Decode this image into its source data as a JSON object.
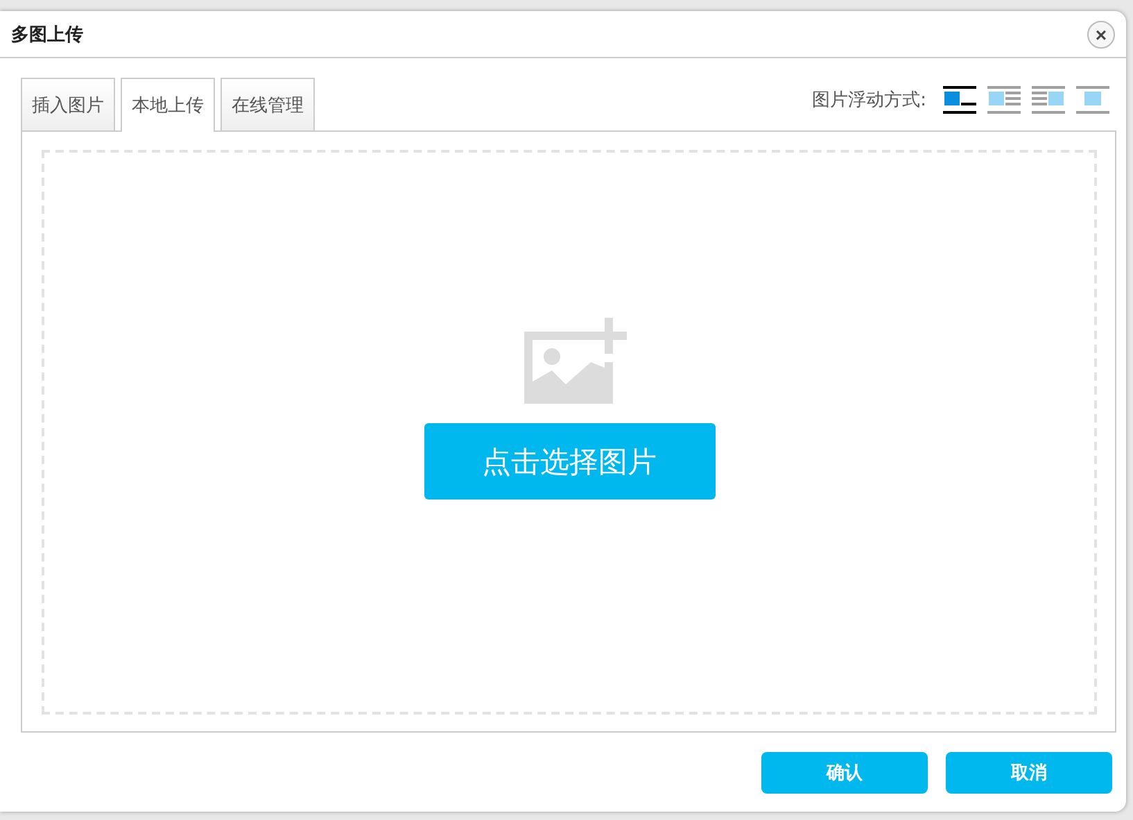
{
  "window": {
    "title": "多图上传",
    "close": "×"
  },
  "tabs": [
    {
      "label": "插入图片",
      "selected": false
    },
    {
      "label": "本地上传",
      "selected": true
    },
    {
      "label": "在线管理",
      "selected": false
    }
  ],
  "float": {
    "label": "图片浮动方式:",
    "options": [
      {
        "kind": "none",
        "selected": true
      },
      {
        "kind": "left",
        "selected": false
      },
      {
        "kind": "right",
        "selected": false
      },
      {
        "kind": "center",
        "selected": false
      }
    ]
  },
  "upload": {
    "button": "点击选择图片"
  },
  "buttons": [
    "确认",
    "取消"
  ]
}
